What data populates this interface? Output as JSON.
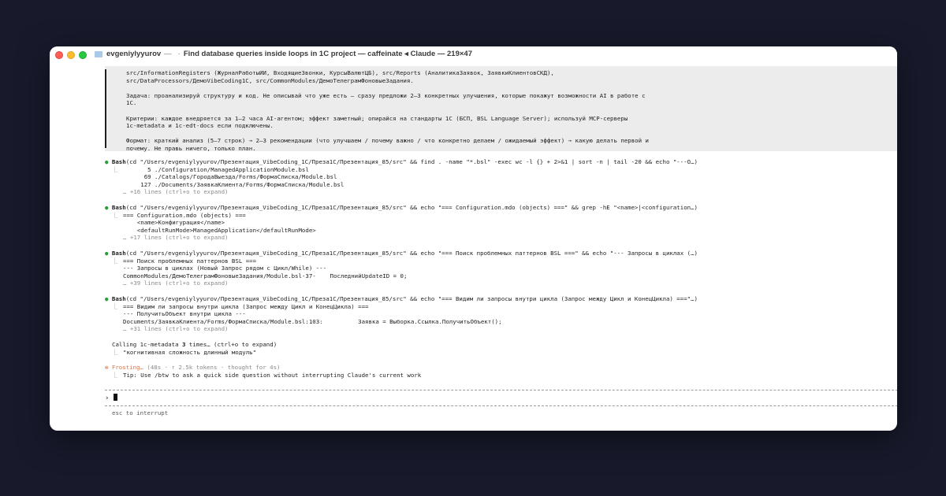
{
  "window": {
    "title_user": "evgeniylyyurov",
    "title_sep": "—",
    "title_sep2": "·",
    "title_rest": "Find database queries inside loops in 1C project — caffeinate ◂ Claude — 219×47"
  },
  "prompt": {
    "lines": [
      "src/InformationRegisters (ЖурналРаботыИИ, ВходящиеЗвонки, КурсыВалютЦБ), src/Reports (АналитикаЗаявок, ЗаявкиКлиентовСКД),",
      "src/DataProcessors/ДемоVibeCoding1C, src/CommonModules/ДемоТелеграмФоновыеЗадания.",
      "",
      "Задача: проанализируй структуру и код. Не описывай что уже есть — сразу предложи 2–3 конкретных улучшения, которые покажут возможности AI в работе с",
      "1С.",
      "",
      "Критерии: каждое внедряется за 1–2 часа AI-агентом; эффект заметный; опирайся на стандарты 1С (БСП, BSL Language Server); используй MCP-серверы",
      "1c-metadata и 1c-edt-docs если подключены.",
      "",
      "Формат: краткий анализ (5–7 строк) → 2–3 рекомендации (что улучшаем / почему важно / что конкретно делаем / ожидаемый эффект) → какую делать первой и",
      "почему. Не правь ничего, только план."
    ]
  },
  "blocks": [
    {
      "tool": "Bash",
      "cmd": "(cd \"/Users/evgeniylyyurov/Презентация_VibeCoding_1C/Преза1C/Презентация_85/src\" && find . -name \"*.bsl\" -exec wc -l {} + 2>&1 | sort -n | tail -20 && echo \"---O…)",
      "output": [
        "       5 ./Configuration/ManagedApplicationModule.bsl",
        "      69 ./Catalogs/ГородаВыезда/Forms/ФормаСписка/Module.bsl",
        "     127 ./Documents/ЗаявкаКлиента/Forms/ФормаСписка/Module.bsl"
      ],
      "more": "… +16 lines (ctrl+o to expand)"
    },
    {
      "tool": "Bash",
      "cmd": "(cd \"/Users/evgeniylyyurov/Презентация_VibeCoding_1C/Преза1C/Презентация_85/src\" && echo \"=== Configuration.mdo (objects) ===\" && grep -hE \"<name>|<configuration…)",
      "output": [
        "=== Configuration.mdo (objects) ===",
        "    <name>Конфигурация</name>",
        "    <defaultRunMode>ManagedApplication</defaultRunMode>"
      ],
      "more": "… +17 lines (ctrl+o to expand)"
    },
    {
      "tool": "Bash",
      "cmd": "(cd \"/Users/evgeniylyyurov/Презентация_VibeCoding_1C/Преза1C/Презентация_85/src\" && echo \"=== Поиск проблемных паттернов BSL ===\" && echo \"--- Запросы в циклах (…)",
      "output": [
        "=== Поиск проблемных паттернов BSL ===",
        "--- Запросы в циклах (Новый Запрос рядом с Цикл/While) ---",
        "CommonModules/ДемоТелеграмФоновыеЗадания/Module.bsl-37-    ПоследнийUpdateID = 0;"
      ],
      "more": "… +39 lines (ctrl+o to expand)"
    },
    {
      "tool": "Bash",
      "cmd": "(cd \"/Users/evgeniylyyurov/Презентация_VibeCoding_1C/Преза1C/Презентация_85/src\" && echo \"=== Видим ли запросы внутри цикла (Запрос между Цикл и КонецЦикла) ===\"…)",
      "output": [
        "=== Видим ли запросы внутри цикла (Запрос между Цикл и КонецЦикла) ===",
        "--- ПолучитьОбъект внутри цикла ---",
        "Documents/ЗаявкаКлиента/Forms/ФормаСписка/Module.bsl:103:          Заявка = Выборка.Ссылка.ПолучитьОбъект();"
      ],
      "more": "… +31 lines (ctrl+o to expand)"
    }
  ],
  "calling": {
    "prefix": "Calling 1c-metadata ",
    "count": "3",
    "suffix": " times… (ctrl+o to expand)",
    "detail": "\"когнитивная сложность длинный модуль\""
  },
  "status": {
    "verb": "Frosting…",
    "meta": " (48s · ↑ 2.5k tokens · thought for 4s)",
    "tip": "Tip: Use /btw to ask a quick side question without interrupting Claude's current work"
  },
  "input": {
    "prompt_symbol": "›",
    "value": ""
  },
  "footer": {
    "hint": "esc to interrupt"
  },
  "glyphs": {
    "bullet": "●",
    "elbow": "⎿",
    "asterisk": "✻"
  },
  "colors": {
    "success_dot": "#2e9a3c",
    "accent": "#d9764c",
    "prompt_bg": "#ececec"
  }
}
